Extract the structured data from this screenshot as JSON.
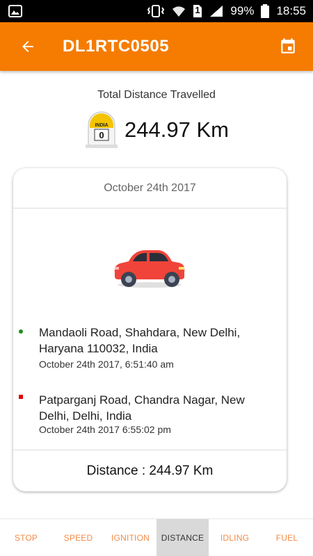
{
  "status_bar": {
    "battery_percent": "99%",
    "time": "18:55",
    "sim_slot": "1",
    "icons": [
      "image-icon",
      "vibrate-icon",
      "wifi-icon",
      "sim-icon",
      "signal-icon",
      "battery-icon"
    ]
  },
  "header": {
    "title": "DL1RTC0505",
    "back_icon": "arrow-back-icon",
    "calendar_icon": "calendar-icon",
    "background_color": "#f57c00"
  },
  "summary": {
    "label": "Total Distance Travelled",
    "value": "244.97 Km",
    "milestone_country": "INDIA",
    "milestone_number": "0"
  },
  "trip_card": {
    "date": "October 24th 2017",
    "start": {
      "address": "Mandaoli Road, Shahdara, New Delhi, Haryana 110032, India",
      "time": "October 24th 2017, 6:51:40 am",
      "marker_color": "#1e8e1e"
    },
    "end": {
      "address": "Patparganj Road, Chandra Nagar, New Delhi, Delhi, India",
      "time": "October 24th 2017 6:55:02 pm",
      "marker_color": "#e00000"
    },
    "distance": "Distance : 244.97 Km"
  },
  "tabs": [
    {
      "label": "STOP",
      "active": false
    },
    {
      "label": "SPEED",
      "active": false
    },
    {
      "label": "IGNITION",
      "active": false
    },
    {
      "label": "DISTANCE",
      "active": true
    },
    {
      "label": "IDLING",
      "active": false
    },
    {
      "label": "FUEL",
      "active": false
    }
  ]
}
